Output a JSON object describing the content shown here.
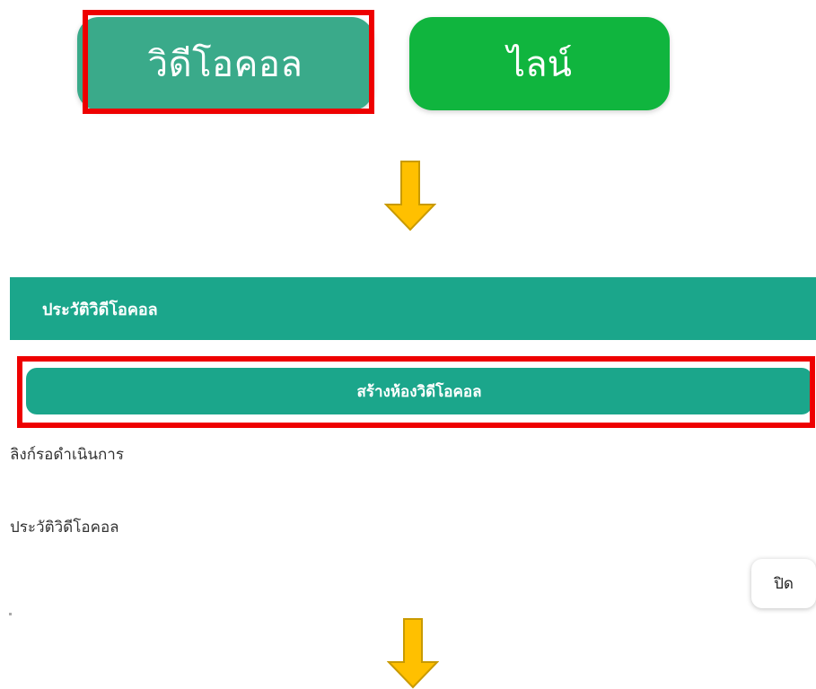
{
  "top_buttons": {
    "video_call_label": "วิดีโอคอล",
    "line_label": "ไลน์"
  },
  "panel": {
    "title": "ประวัติวิดีโอคอล",
    "create_room_label": "สร้างห้องวิดีโอคอล",
    "pending_links_label": "ลิงก์รอดำเนินการ",
    "history_label": "ประวัติวิดีโอคอล",
    "close_label": "ปิด"
  },
  "colors": {
    "video_button": "#3aaa8a",
    "line_button": "#10b53e",
    "panel_green": "#1ba68b",
    "highlight_red": "#ee0000",
    "arrow_yellow": "#ffc000"
  },
  "icons": [
    "arrow-down-icon",
    "arrow-down-icon"
  ]
}
